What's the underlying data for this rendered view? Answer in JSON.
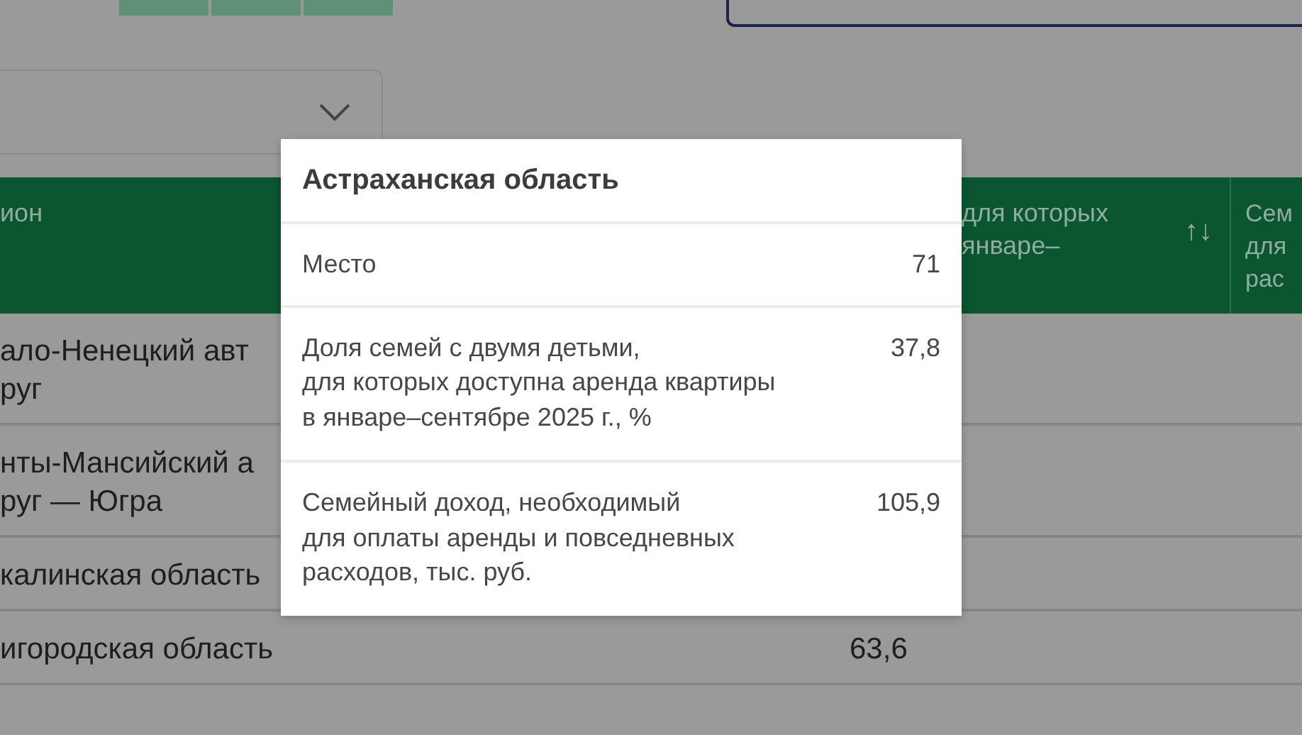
{
  "table": {
    "columns": [
      {
        "label": "ион"
      },
      {
        "label": "для которых\nянваре–",
        "sort_icon": "↑↓"
      },
      {
        "label": "Сем\nдля\nрас"
      }
    ],
    "rows": [
      {
        "region_lines": [
          "ало-Ненецкий авт",
          "руг"
        ]
      },
      {
        "region_lines": [
          "нты-Мансийский а",
          "руг — Югра"
        ]
      },
      {
        "region_lines": [
          "калинская область"
        ]
      },
      {
        "region_lines": [
          "игородская область"
        ],
        "value": "63,6"
      }
    ]
  },
  "popup": {
    "title": "Астраханская область",
    "rows": [
      {
        "label": "Место",
        "value": "71"
      },
      {
        "label": "Доля семей с двумя детьми,\nдля которых доступна аренда квартиры\nв январе–сентябре 2025 г., %",
        "value": "37,8"
      },
      {
        "label": "Семейный доход, необходимый\nдля оплаты аренды и повседневных\nрасходов, тыс. руб.",
        "value": "105,9"
      }
    ]
  }
}
